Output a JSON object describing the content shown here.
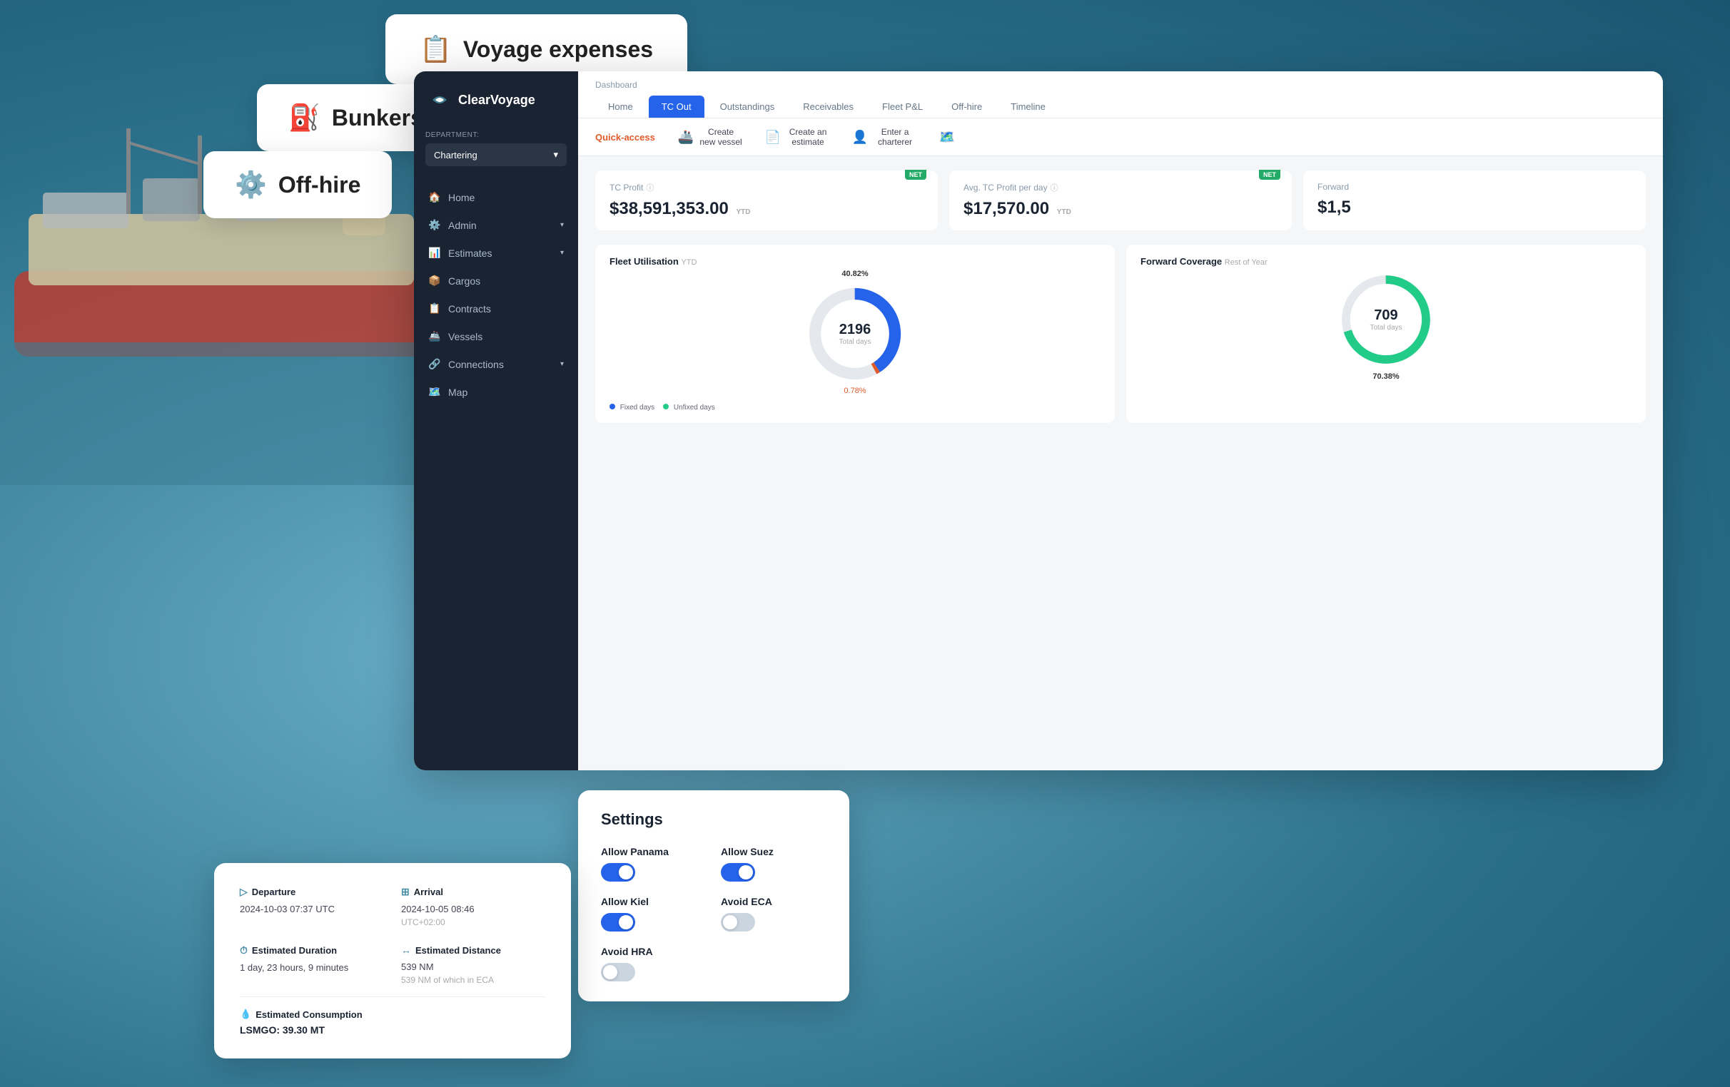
{
  "background": {
    "color": "#4a8fa8"
  },
  "floating_cards": {
    "voyage_expenses": {
      "title": "Voyage expenses",
      "icon": "📋"
    },
    "bunkers": {
      "title": "Bunkers",
      "icon": "⛽"
    },
    "offhire": {
      "title": "Off-hire",
      "icon": "⚙️"
    }
  },
  "app": {
    "logo": "ClearVoyage",
    "header": {
      "breadcrumb": "Dashboard",
      "dept_label": "Department:",
      "dept_value": "Chartering",
      "tabs": [
        "Home",
        "TC Out",
        "Outstandings",
        "Receivables",
        "Fleet P&L",
        "Off-hire",
        "Timeline"
      ],
      "active_tab": "TC Out"
    },
    "quick_access": {
      "label": "Quick-access",
      "actions": [
        {
          "label": "Create new vessel",
          "icon": "🚢"
        },
        {
          "label": "Create an estimate",
          "icon": "📄"
        },
        {
          "label": "Enter a charterer",
          "icon": "👤"
        }
      ]
    },
    "metrics": [
      {
        "label": "TC Profit",
        "value": "$38,591,353.00",
        "period": "YTD",
        "net": true
      },
      {
        "label": "Avg. TC Profit per day",
        "value": "$17,570.00",
        "period": "YTD",
        "net": true
      },
      {
        "label": "Forward",
        "value": "$1,5",
        "period": "",
        "net": false
      }
    ],
    "charts": {
      "fleet_utilisation": {
        "title": "Fleet Utilisation",
        "subtitle": "YTD",
        "percentage": "40.82%",
        "total_days": 2196,
        "total_days_label": "Total days",
        "small_pct": "0.78%"
      },
      "forward_coverage": {
        "title": "Forward Coverage",
        "subtitle": "Rest of Year",
        "percentage": "70.38%",
        "total_days": 709,
        "total_days_label": "Total days"
      }
    },
    "chart_legend": {
      "fixed": "Fixed days",
      "unfixed": "Unfixed days"
    }
  },
  "sidebar": {
    "nav_items": [
      {
        "label": "Home",
        "icon": "🏠",
        "has_arrow": false
      },
      {
        "label": "Admin",
        "icon": "⚙️",
        "has_arrow": true
      },
      {
        "label": "Estimates",
        "icon": "📊",
        "has_arrow": true
      },
      {
        "label": "Cargos",
        "icon": "📦",
        "has_arrow": false
      },
      {
        "label": "Contracts",
        "icon": "📋",
        "has_arrow": false
      },
      {
        "label": "Vessels",
        "icon": "🚢",
        "has_arrow": false
      },
      {
        "label": "Connections",
        "icon": "🔗",
        "has_arrow": true
      },
      {
        "label": "Map",
        "icon": "🗺️",
        "has_arrow": false
      }
    ]
  },
  "settings_card": {
    "title": "Settings",
    "settings": [
      {
        "label": "Allow Panama",
        "value": true
      },
      {
        "label": "Allow Suez",
        "value": true
      },
      {
        "label": "Allow Kiel",
        "value": true
      },
      {
        "label": "Avoid ECA",
        "value": false
      },
      {
        "label": "Avoid HRA",
        "value": false
      }
    ]
  },
  "journey_card": {
    "departure": {
      "label": "Departure",
      "value": "2024-10-03 07:37 UTC"
    },
    "arrival": {
      "label": "Arrival",
      "value": "2024-10-05 08:46",
      "sub": "UTC+02:00"
    },
    "estimated_duration": {
      "label": "Estimated Duration",
      "value": "1 day, 23 hours, 9 minutes"
    },
    "estimated_distance": {
      "label": "Estimated Distance",
      "value": "539 NM",
      "sub": "539 NM of which in ECA"
    },
    "estimated_consumption": {
      "label": "Estimated Consumption",
      "value": "LSMGO: 39.30 MT"
    }
  }
}
